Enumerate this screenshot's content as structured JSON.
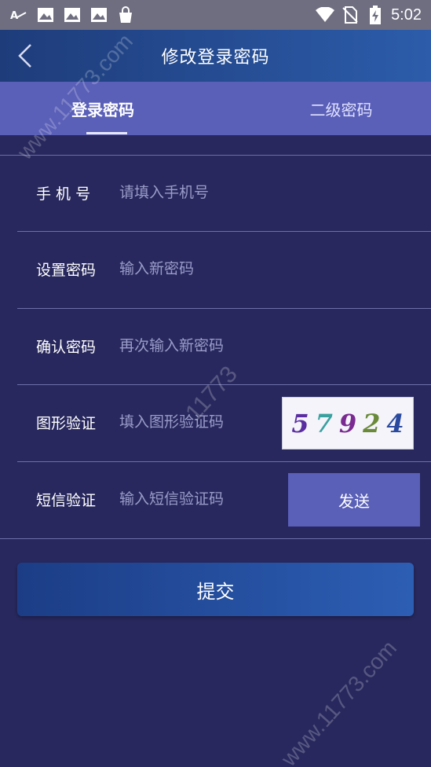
{
  "status_bar": {
    "time": "5:02",
    "left_icons": [
      "font-app-icon",
      "image-icon",
      "image-icon",
      "image-icon",
      "bag-icon"
    ],
    "right_icons": [
      "wifi-icon",
      "sim-off-icon",
      "battery-charging-icon"
    ]
  },
  "nav": {
    "title": "修改登录密码",
    "back_icon": "chevron-left-icon"
  },
  "tabs": [
    {
      "label": "登录密码",
      "active": true
    },
    {
      "label": "二级密码",
      "active": false
    }
  ],
  "form": {
    "phone": {
      "label": "手 机 号",
      "placeholder": "请填入手机号"
    },
    "new_password": {
      "label": "设置密码",
      "placeholder": "输入新密码"
    },
    "confirm_password": {
      "label": "确认密码",
      "placeholder": "再次输入新密码"
    },
    "captcha": {
      "label": "图形验证",
      "placeholder": "填入图形验证码",
      "code_digits": [
        "5",
        "7",
        "9",
        "2",
        "4"
      ]
    },
    "sms": {
      "label": "短信验证",
      "placeholder": "输入短信验证码",
      "send_label": "发送"
    }
  },
  "submit_label": "提交",
  "watermarks": [
    "www.11773.com",
    "11773",
    "www.11773.com"
  ],
  "colors": {
    "background": "#28285e",
    "tab_bar": "#5a5fb8",
    "send_button": "#5a5fb8",
    "nav_gradient_start": "#1e3c7a",
    "nav_gradient_end": "#2c5caa",
    "captcha_digits": [
      "#5a2ea0",
      "#3aa0a0",
      "#7a2a90",
      "#6a8a3a",
      "#2a4aa0"
    ]
  }
}
